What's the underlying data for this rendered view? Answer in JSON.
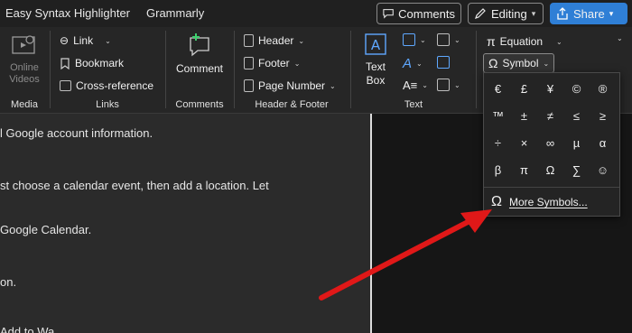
{
  "tabbar": {
    "tabs": [
      "Easy Syntax Highlighter",
      "Grammarly"
    ],
    "comments_label": "Comments",
    "editing_label": "Editing",
    "share_label": "Share"
  },
  "ribbon": {
    "media": {
      "online_videos": "Online Videos",
      "group": "Media"
    },
    "links": {
      "link": "Link",
      "bookmark": "Bookmark",
      "cross_reference": "Cross-reference",
      "group": "Links"
    },
    "comments": {
      "comment": "Comment",
      "group": "Comments"
    },
    "header_footer": {
      "header": "Header",
      "footer": "Footer",
      "page_number": "Page Number",
      "group": "Header & Footer"
    },
    "text": {
      "text_box": "Text Box",
      "group": "Text"
    },
    "symbols": {
      "equation": "Equation",
      "symbol": "Symbol"
    }
  },
  "document": {
    "lines": [
      "l Google account information.",
      "st choose a calendar event, then add a location. Let",
      "Google Calendar.",
      "on.",
      "Add to Wa                                              "
    ]
  },
  "symbol_menu": {
    "symbols": [
      "€",
      "£",
      "¥",
      "©",
      "®",
      "™",
      "±",
      "≠",
      "≤",
      "≥",
      "÷",
      "×",
      "∞",
      "µ",
      "α",
      "β",
      "π",
      "Ω",
      "∑",
      "☺"
    ],
    "more_symbols": "More Symbols..."
  },
  "colors": {
    "accent": "#2f7fd6",
    "arrow": "#e01818"
  }
}
